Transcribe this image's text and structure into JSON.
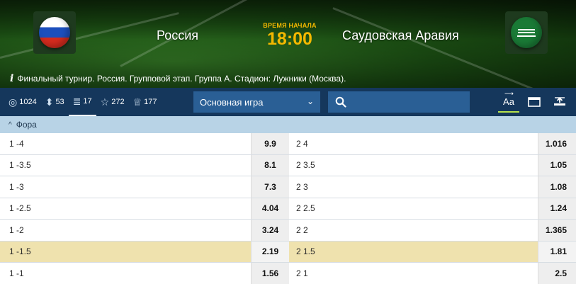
{
  "match": {
    "home_team": "Россия",
    "away_team": "Саудовская Аравия",
    "start_label": "ВРЕМЯ НАЧАЛА",
    "start_time": "18:00",
    "info": "Финальный турнир. Россия. Групповой этап. Группа А. Стадион: Лужники (Москва)."
  },
  "toolbar": {
    "stats": [
      {
        "icon": "target-icon",
        "value": "1024"
      },
      {
        "icon": "sort-icon",
        "value": "53"
      },
      {
        "icon": "bars-icon",
        "value": "17"
      },
      {
        "icon": "star-icon",
        "value": "272"
      },
      {
        "icon": "trophy-icon",
        "value": "177"
      }
    ],
    "market_select": "Основная игра",
    "font_toggle": "Aa"
  },
  "section": {
    "title": "Фора"
  },
  "rows": [
    {
      "left_label": "1 -4",
      "left_odd": "9.9",
      "right_label": "2 4",
      "right_odd": "1.016",
      "highlighted": false
    },
    {
      "left_label": "1 -3.5",
      "left_odd": "8.1",
      "right_label": "2 3.5",
      "right_odd": "1.05",
      "highlighted": false
    },
    {
      "left_label": "1 -3",
      "left_odd": "7.3",
      "right_label": "2 3",
      "right_odd": "1.08",
      "highlighted": false
    },
    {
      "left_label": "1 -2.5",
      "left_odd": "4.04",
      "right_label": "2 2.5",
      "right_odd": "1.24",
      "highlighted": false
    },
    {
      "left_label": "1 -2",
      "left_odd": "3.24",
      "right_label": "2 2",
      "right_odd": "1.365",
      "highlighted": false
    },
    {
      "left_label": "1 -1.5",
      "left_odd": "2.19",
      "right_label": "2 1.5",
      "right_odd": "1.81",
      "highlighted": true
    },
    {
      "left_label": "1 -1",
      "left_odd": "1.56",
      "right_label": "2 1",
      "right_odd": "2.5",
      "highlighted": false
    }
  ]
}
